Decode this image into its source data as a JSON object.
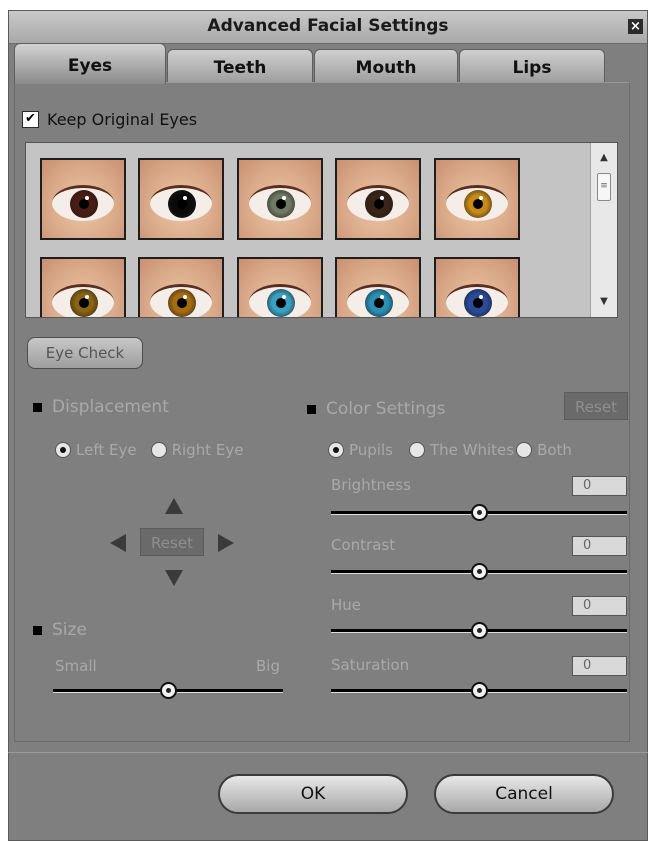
{
  "window": {
    "title": "Advanced Facial Settings",
    "close_glyph": "×"
  },
  "tabs": [
    {
      "label": "Eyes",
      "active": true
    },
    {
      "label": "Teeth",
      "active": false
    },
    {
      "label": "Mouth",
      "active": false
    },
    {
      "label": "Lips",
      "active": false
    }
  ],
  "keep_original": {
    "label": "Keep Original Eyes",
    "checked": true,
    "check_glyph": "✔"
  },
  "gallery": {
    "thumbnails": [
      {
        "iris_color": "#4a1c14"
      },
      {
        "iris_color": "#0a0a0a"
      },
      {
        "iris_color": "#6e7a62"
      },
      {
        "iris_color": "#3a2418"
      },
      {
        "iris_color": "#c88a18"
      },
      {
        "iris_color": "#8a6412"
      },
      {
        "iris_color": "#a66c12"
      },
      {
        "iris_color": "#3aa0c0"
      },
      {
        "iris_color": "#2c8fb4"
      },
      {
        "iris_color": "#2a4a9a"
      }
    ],
    "scroll_up_glyph": "▲",
    "scroll_down_glyph": "▼",
    "scroll_grip_glyph": "≡"
  },
  "eye_check_label": "Eye Check",
  "displacement": {
    "title": "Displacement",
    "left_eye": "Left Eye",
    "right_eye": "Right Eye",
    "selected": "Left Eye",
    "reset_label": "Reset"
  },
  "size": {
    "title": "Size",
    "min_label": "Small",
    "max_label": "Big",
    "value": 0.5
  },
  "color_settings": {
    "title": "Color Settings",
    "reset_label": "Reset",
    "options": [
      "Pupils",
      "The Whites",
      "Both"
    ],
    "selected": "Pupils",
    "sliders": [
      {
        "label": "Brightness",
        "value": "0"
      },
      {
        "label": "Contrast",
        "value": "0"
      },
      {
        "label": "Hue",
        "value": "0"
      },
      {
        "label": "Saturation",
        "value": "0"
      }
    ]
  },
  "buttons": {
    "ok": "OK",
    "cancel": "Cancel"
  }
}
